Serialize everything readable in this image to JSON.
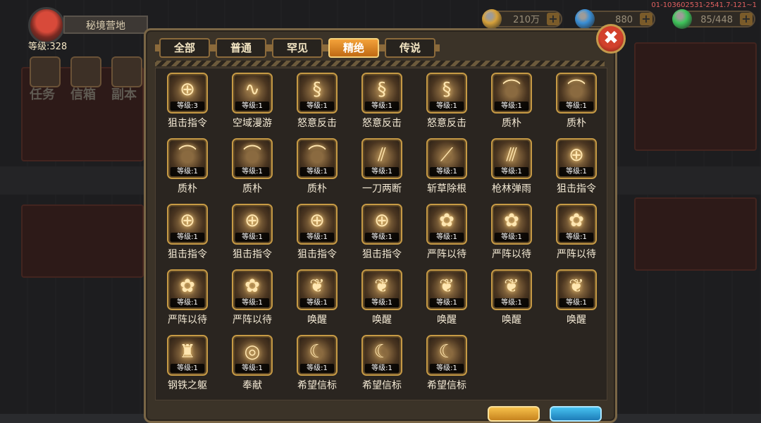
{
  "hud": {
    "area_name": "秘境营地",
    "player_level": "等级:328",
    "side_buttons": [
      "任务",
      "信箱",
      "副本"
    ],
    "server_id": "01-103602531-2541.7-121~1"
  },
  "resources": [
    {
      "name": "gold-coin-icon",
      "value": "210万",
      "color": "#d6a13a"
    },
    {
      "name": "gem-icon",
      "value": "880",
      "color": "#3a8fd6"
    },
    {
      "name": "energy-icon",
      "value": "85/448",
      "color": "#3ec45a"
    }
  ],
  "tabs": [
    {
      "label": "全部",
      "active": false
    },
    {
      "label": "普通",
      "active": false
    },
    {
      "label": "罕见",
      "active": false
    },
    {
      "label": "精绝",
      "active": true
    },
    {
      "label": "传说",
      "active": false
    }
  ],
  "skills": [
    {
      "name": "狙击指令",
      "level": "等级:3",
      "icon": "crosshair-icon",
      "glyph": "⊕"
    },
    {
      "name": "空域漫游",
      "level": "等级:1",
      "icon": "swirl-icon",
      "glyph": "∿"
    },
    {
      "name": "怒意反击",
      "level": "等级:1",
      "icon": "serpent-icon",
      "glyph": "§"
    },
    {
      "name": "怒意反击",
      "level": "等级:1",
      "icon": "serpent-icon",
      "glyph": "§"
    },
    {
      "name": "怒意反击",
      "level": "等级:1",
      "icon": "serpent-icon",
      "glyph": "§"
    },
    {
      "name": "质朴",
      "level": "等级:1",
      "icon": "bow-icon",
      "glyph": "⌒"
    },
    {
      "name": "质朴",
      "level": "等级:1",
      "icon": "bow-icon",
      "glyph": "⌒"
    },
    {
      "name": "质朴",
      "level": "等级:1",
      "icon": "bow-icon",
      "glyph": "⌒"
    },
    {
      "name": "质朴",
      "level": "等级:1",
      "icon": "bow-icon",
      "glyph": "⌒"
    },
    {
      "name": "质朴",
      "level": "等级:1",
      "icon": "bow-icon",
      "glyph": "⌒"
    },
    {
      "name": "一刀两断",
      "level": "等级:1",
      "icon": "claw-slash-icon",
      "glyph": "⫽"
    },
    {
      "name": "斩草除根",
      "level": "等级:1",
      "icon": "blade-slash-icon",
      "glyph": "⟋"
    },
    {
      "name": "枪林弹雨",
      "level": "等级:1",
      "icon": "bullet-rain-icon",
      "glyph": "⫻"
    },
    {
      "name": "狙击指令",
      "level": "等级:1",
      "icon": "crosshair-icon",
      "glyph": "⊕"
    },
    {
      "name": "狙击指令",
      "level": "等级:1",
      "icon": "crosshair-icon",
      "glyph": "⊕"
    },
    {
      "name": "狙击指令",
      "level": "等级:1",
      "icon": "crosshair-icon",
      "glyph": "⊕"
    },
    {
      "name": "狙击指令",
      "level": "等级:1",
      "icon": "crosshair-icon",
      "glyph": "⊕"
    },
    {
      "name": "狙击指令",
      "level": "等级:1",
      "icon": "crosshair-icon",
      "glyph": "⊕"
    },
    {
      "name": "严阵以待",
      "level": "等级:1",
      "icon": "shield-triangle-icon",
      "glyph": "✿"
    },
    {
      "name": "严阵以待",
      "level": "等级:1",
      "icon": "shield-triangle-icon",
      "glyph": "✿"
    },
    {
      "name": "严阵以待",
      "level": "等级:1",
      "icon": "shield-triangle-icon",
      "glyph": "✿"
    },
    {
      "name": "严阵以待",
      "level": "等级:1",
      "icon": "shield-triangle-icon",
      "glyph": "✿"
    },
    {
      "name": "严阵以待",
      "level": "等级:1",
      "icon": "shield-triangle-icon",
      "glyph": "✿"
    },
    {
      "name": "唤醒",
      "level": "等级:1",
      "icon": "sprout-icon",
      "glyph": "❦"
    },
    {
      "name": "唤醒",
      "level": "等级:1",
      "icon": "sprout-icon",
      "glyph": "❦"
    },
    {
      "name": "唤醒",
      "level": "等级:1",
      "icon": "sprout-icon",
      "glyph": "❦"
    },
    {
      "name": "唤醒",
      "level": "等级:1",
      "icon": "sprout-icon",
      "glyph": "❦"
    },
    {
      "name": "唤醒",
      "level": "等级:1",
      "icon": "sprout-icon",
      "glyph": "❦"
    },
    {
      "name": "钢铁之躯",
      "level": "等级:1",
      "icon": "armor-icon",
      "glyph": "♜"
    },
    {
      "name": "奉献",
      "level": "等级:1",
      "icon": "sun-ring-icon",
      "glyph": "◎"
    },
    {
      "name": "希望信标",
      "level": "等级:1",
      "icon": "moon-beacon-icon",
      "glyph": "☾"
    },
    {
      "name": "希望信标",
      "level": "等级:1",
      "icon": "moon-beacon-icon",
      "glyph": "☾"
    },
    {
      "name": "希望信标",
      "level": "等级:1",
      "icon": "moon-beacon-icon",
      "glyph": "☾"
    }
  ],
  "close_glyph": "✖"
}
